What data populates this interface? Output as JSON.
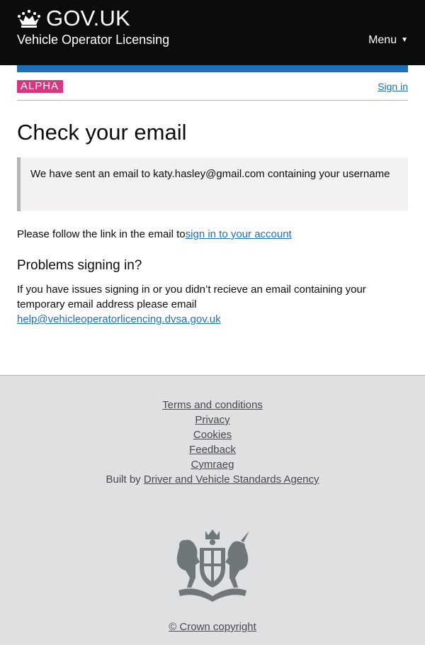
{
  "header": {
    "logo_text": "GOV.UK",
    "service_name": "Vehicle Operator Licensing",
    "menu_label": "Menu",
    "menu_arrow": "▼"
  },
  "phase_banner": {
    "tag": "ALPHA",
    "sign_in": "Sign in"
  },
  "main": {
    "title": "Check your email",
    "inset_prefix": "We have sent an email to",
    "email": "katy.hasley@gmail.com",
    "inset_suffix": "containing your username",
    "follow_prefix": "Please follow the link in the email to",
    "follow_link": "sign in to your account",
    "problems_heading": "Problems signing in?",
    "problems_text": "If you have issues signing in or you didn’t recieve an email containing your temporary email address please email",
    "help_email": "help@vehicleoperatorlicencing.dvsa.gov.uk"
  },
  "footer": {
    "links": [
      "Terms and conditions",
      "Privacy",
      "Cookies",
      "Feedback",
      "Cymraeg"
    ],
    "built_by_prefix": "Built by",
    "built_by_link": "Driver and Vehicle Standards Agency",
    "copyright": "© Crown copyright"
  },
  "colors": {
    "header_bg": "#0b0c0c",
    "blue_bar": "#1d70b8",
    "phase_tag": "#d53880",
    "link": "#1d70b8",
    "footer_bg": "#dee0e2"
  }
}
